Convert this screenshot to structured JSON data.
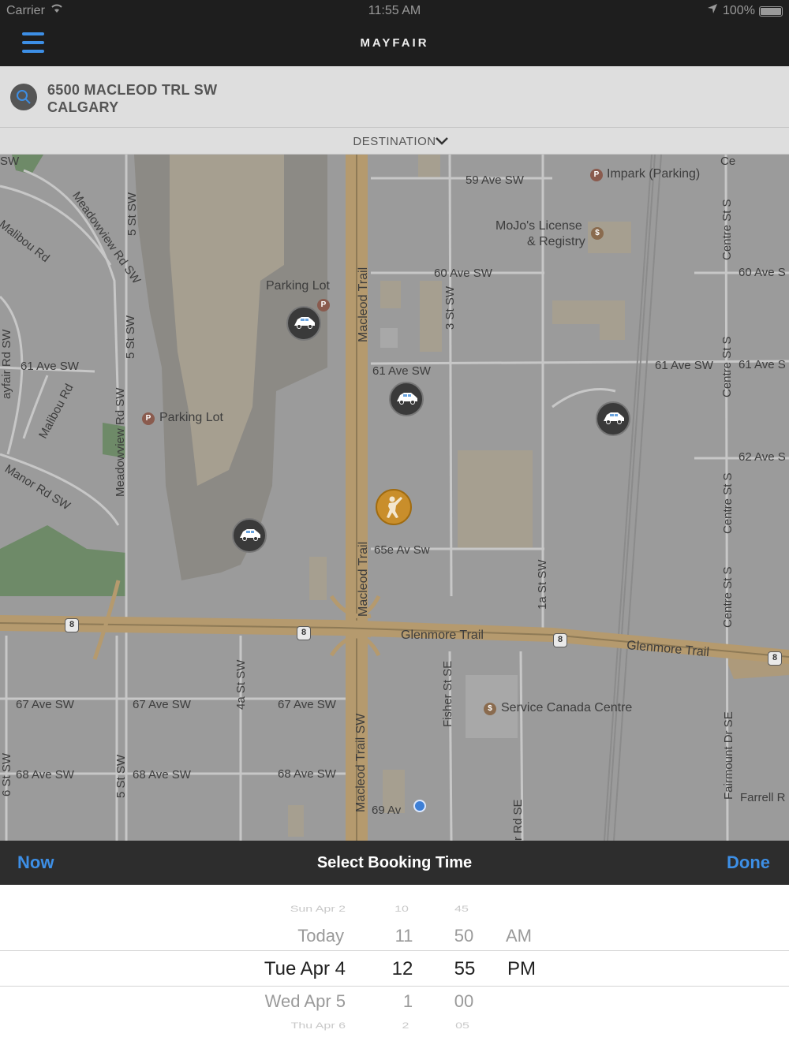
{
  "status_bar": {
    "carrier": "Carrier",
    "time": "11:55 AM",
    "battery": "100%"
  },
  "header": {
    "logo": "MAYFAIR"
  },
  "search": {
    "address_line1": "6500 MACLEOD TRL SW",
    "address_line2": "CALGARY"
  },
  "destination": {
    "label": "DESTINATION"
  },
  "map": {
    "labels": {
      "ave59": "59 Ave SW",
      "impark": "Impark (Parking)",
      "mojos1": "MoJo's License",
      "mojos2": "& Registry",
      "ave60": "60 Ave SW",
      "ave60r": "60 Ave S",
      "parking1": "Parking Lot",
      "ave61l": "61 Ave SW",
      "ave61": "61 Ave SW",
      "ave61r1": "61 Ave SW",
      "ave61r2": "61 Ave S",
      "parking2": "Parking Lot",
      "ave62": "62 Ave S",
      "ave65": "65e Av Sw",
      "glenmore1": "Glenmore Trail",
      "glenmore2": "Glenmore Trail",
      "ave67a": "67 Ave SW",
      "ave67b": "67 Ave SW",
      "ave67c": "67 Ave SW",
      "service": "Service Canada Centre",
      "ave68a": "68 Ave SW",
      "ave68b": "68 Ave SW",
      "ave68c": "68 Ave SW",
      "ave69": "69 Av",
      "farrell": "Farrell R",
      "macleod1": "Macleod Trail",
      "macleod2": "Macleod Trail",
      "macleod3": "Macleod Trail SW",
      "st5a": "5 St SW",
      "st5b": "5 St SW",
      "st5c": "5 St SW",
      "meadow1": "Meadowview Rd SW",
      "meadow2": "Meadowview Rd SW",
      "st3": "3 St SW",
      "st1a": "1a St SW",
      "st4a": "4a St SW",
      "st6": "6 St SW",
      "fisher": "Fisher St SE",
      "centre1": "Centre St S",
      "centre2": "Centre St S",
      "centre3": "Centre St S",
      "centre4": "Centre St S",
      "fairmount": "Fairmount Dr SE",
      "rdse": "r Rd SE",
      "malibou1": "Malibou Rd",
      "malibou2": "Malibou Rd",
      "manor": "Manor Rd SW",
      "mayfair": "ayfair Rd SW",
      "meadowrd": "Meadowview Rd SW",
      "sw": "SW",
      "hwy": "8",
      "ce": "Ce"
    }
  },
  "picker": {
    "toolbar": {
      "now": "Now",
      "title": "Select Booking Time",
      "done": "Done"
    },
    "dates": [
      "Sun Apr 2",
      "Today",
      "Tue Apr 4",
      "Wed Apr 5",
      "Thu Apr 6"
    ],
    "hours": [
      "10",
      "11",
      "12",
      "1",
      "2"
    ],
    "minutes": [
      "45",
      "50",
      "55",
      "00",
      "05"
    ],
    "periods": [
      "AM",
      "PM"
    ],
    "selected": {
      "date": "Tue Apr 4",
      "hour": "12",
      "minute": "55",
      "period": "PM"
    }
  },
  "colors": {
    "accent": "#3d8fe6",
    "bar": "#1e1e1e",
    "map": "#9b9b9b",
    "highway": "#b59a6e",
    "passenger": "#c98e2b"
  }
}
